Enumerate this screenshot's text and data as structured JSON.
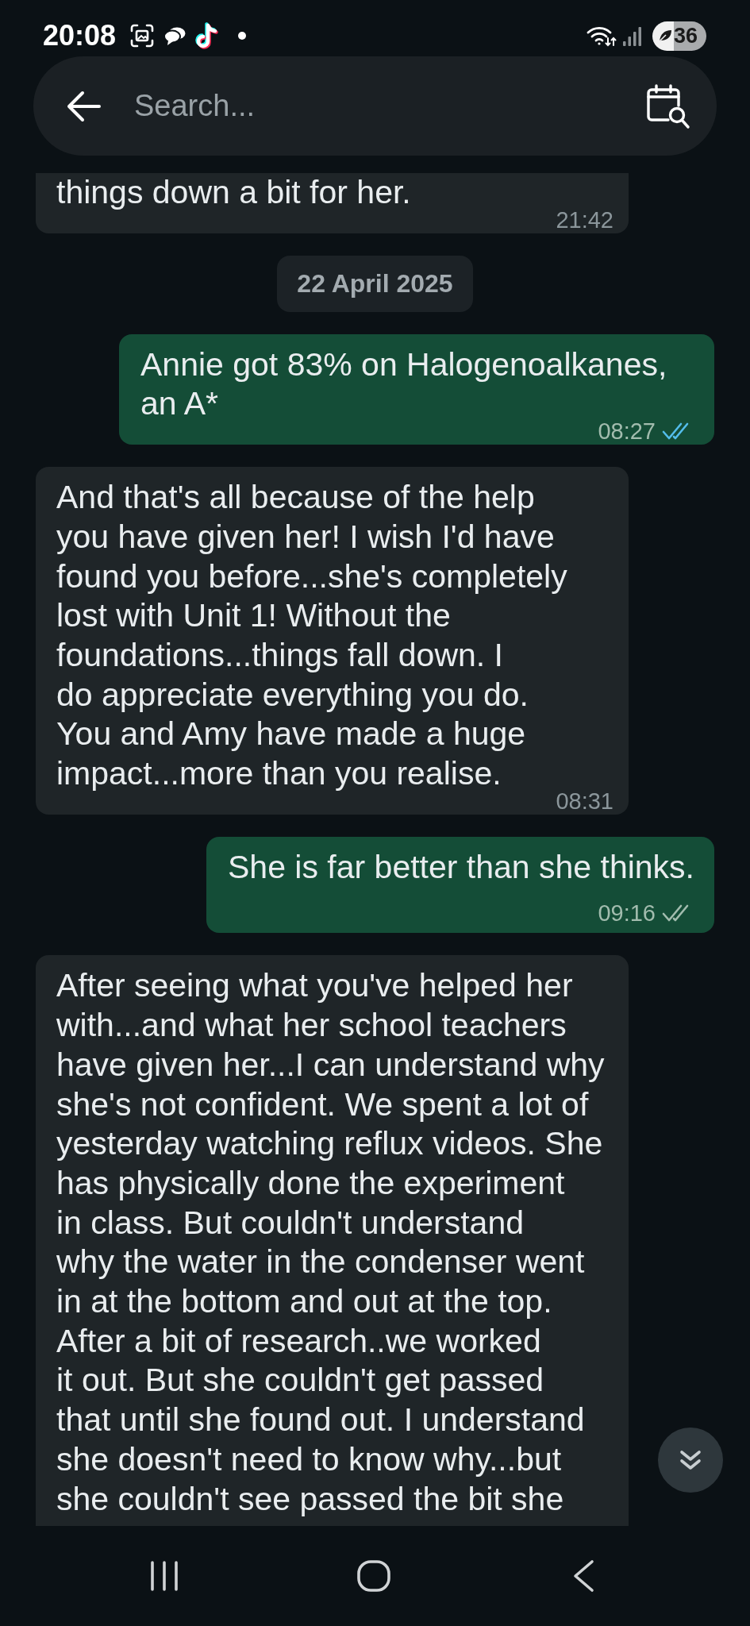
{
  "status_bar": {
    "time": "20:08",
    "battery": "36"
  },
  "search": {
    "placeholder": "Search..."
  },
  "messages": [
    {
      "kind": "incoming",
      "cut_top": true,
      "cut_bottom": false,
      "lines": [
        "things down a bit for her."
      ],
      "time": "21:42"
    },
    {
      "kind": "date",
      "text": "22 April 2025"
    },
    {
      "kind": "outgoing",
      "cut_top": false,
      "cut_bottom": false,
      "lines": [
        "Annie got 83% on Halogenoalkanes,",
        "an A*"
      ],
      "time": "08:27",
      "read": true
    },
    {
      "kind": "incoming",
      "cut_top": false,
      "cut_bottom": false,
      "lines": [
        "And that's all because of the help",
        "you have given her! I wish I'd have",
        "found you before...she's completely",
        "lost with Unit 1! Without the",
        "foundations...things fall down. I",
        "do appreciate everything you do.",
        "You and Amy have made a huge",
        "impact...more than you realise."
      ],
      "time": "08:31"
    },
    {
      "kind": "outgoing",
      "cut_top": false,
      "cut_bottom": false,
      "lines": [
        "She is far better than she thinks."
      ],
      "time": "09:16",
      "read": false
    },
    {
      "kind": "incoming",
      "cut_top": false,
      "cut_bottom": true,
      "lines": [
        "After seeing what you've helped her",
        "with...and what her school teachers",
        "have given her...I can understand why",
        "she's not confident. We spent a lot of",
        "yesterday watching reflux videos. She",
        "has physically done the experiment",
        "in class. But couldn't understand",
        "why the water in the condenser went",
        "in at the bottom and out at the top.",
        "After a bit of research..we worked",
        "it out. But she couldn't get passed",
        "that until she found out. I understand",
        "she doesn't need to know why...but",
        "she couldn't see passed the bit she"
      ]
    }
  ]
}
